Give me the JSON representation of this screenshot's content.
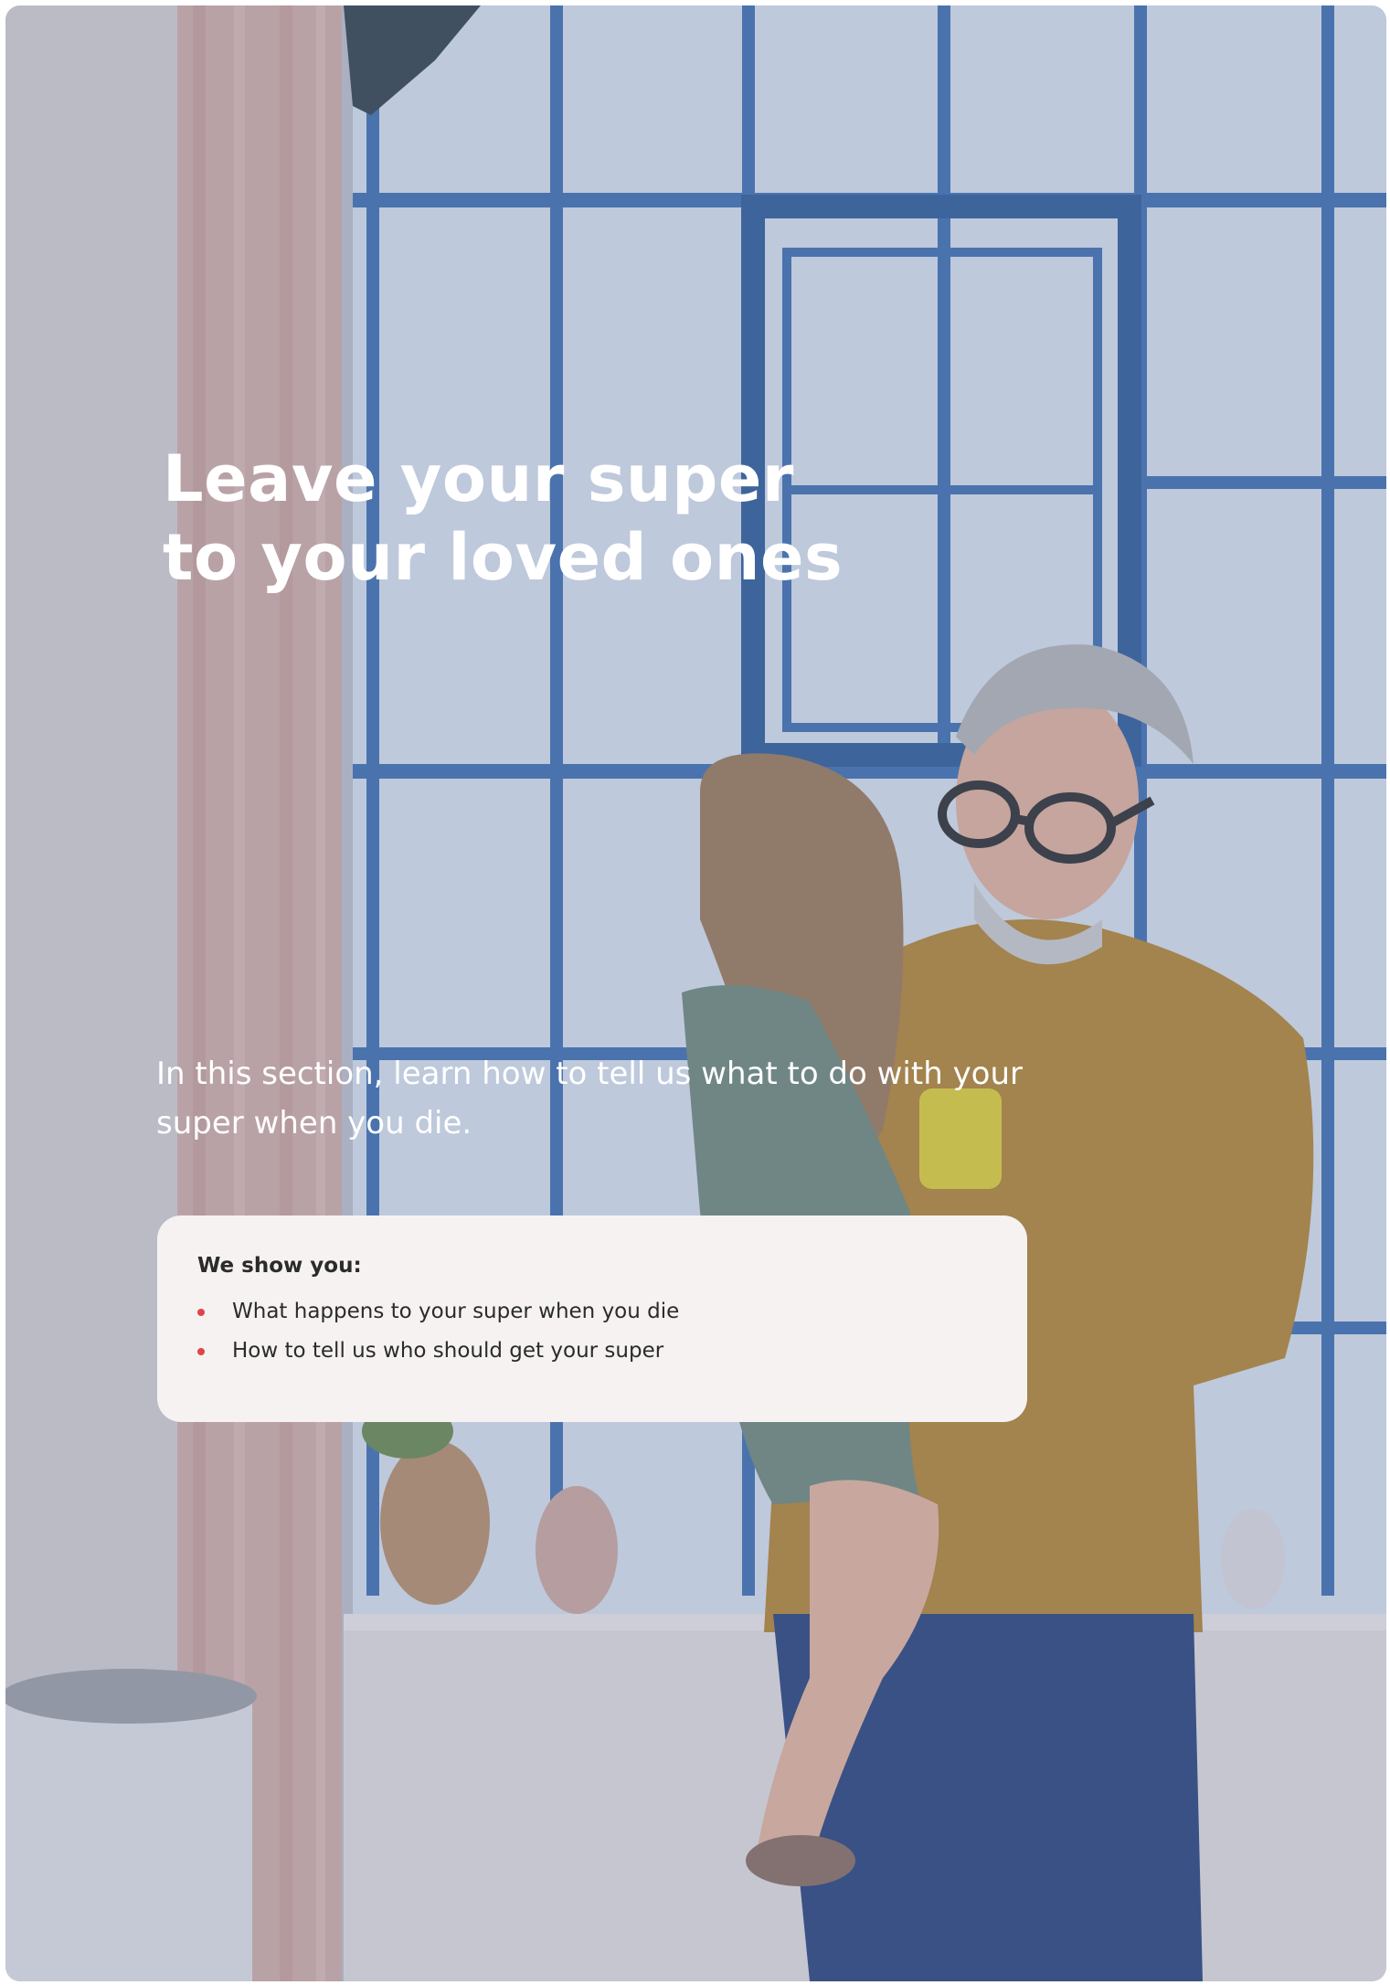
{
  "hero": {
    "image": "grandfather-holding-granddaughter-by-window",
    "title_line1": "Leave your super",
    "title_line2": "to your loved ones"
  },
  "intro": {
    "text": "In this section, learn how to tell us what to do with your super when you die."
  },
  "info_box": {
    "heading": "We show you:",
    "items": [
      {
        "label": "What happens to your super when you die"
      },
      {
        "label": "How to tell us who should get your super"
      }
    ],
    "bullet_color": "#e0444a"
  },
  "colors": {
    "title_text": "#ffffff",
    "box_background": "#f6f2f2",
    "box_text": "#2b2b2b"
  }
}
